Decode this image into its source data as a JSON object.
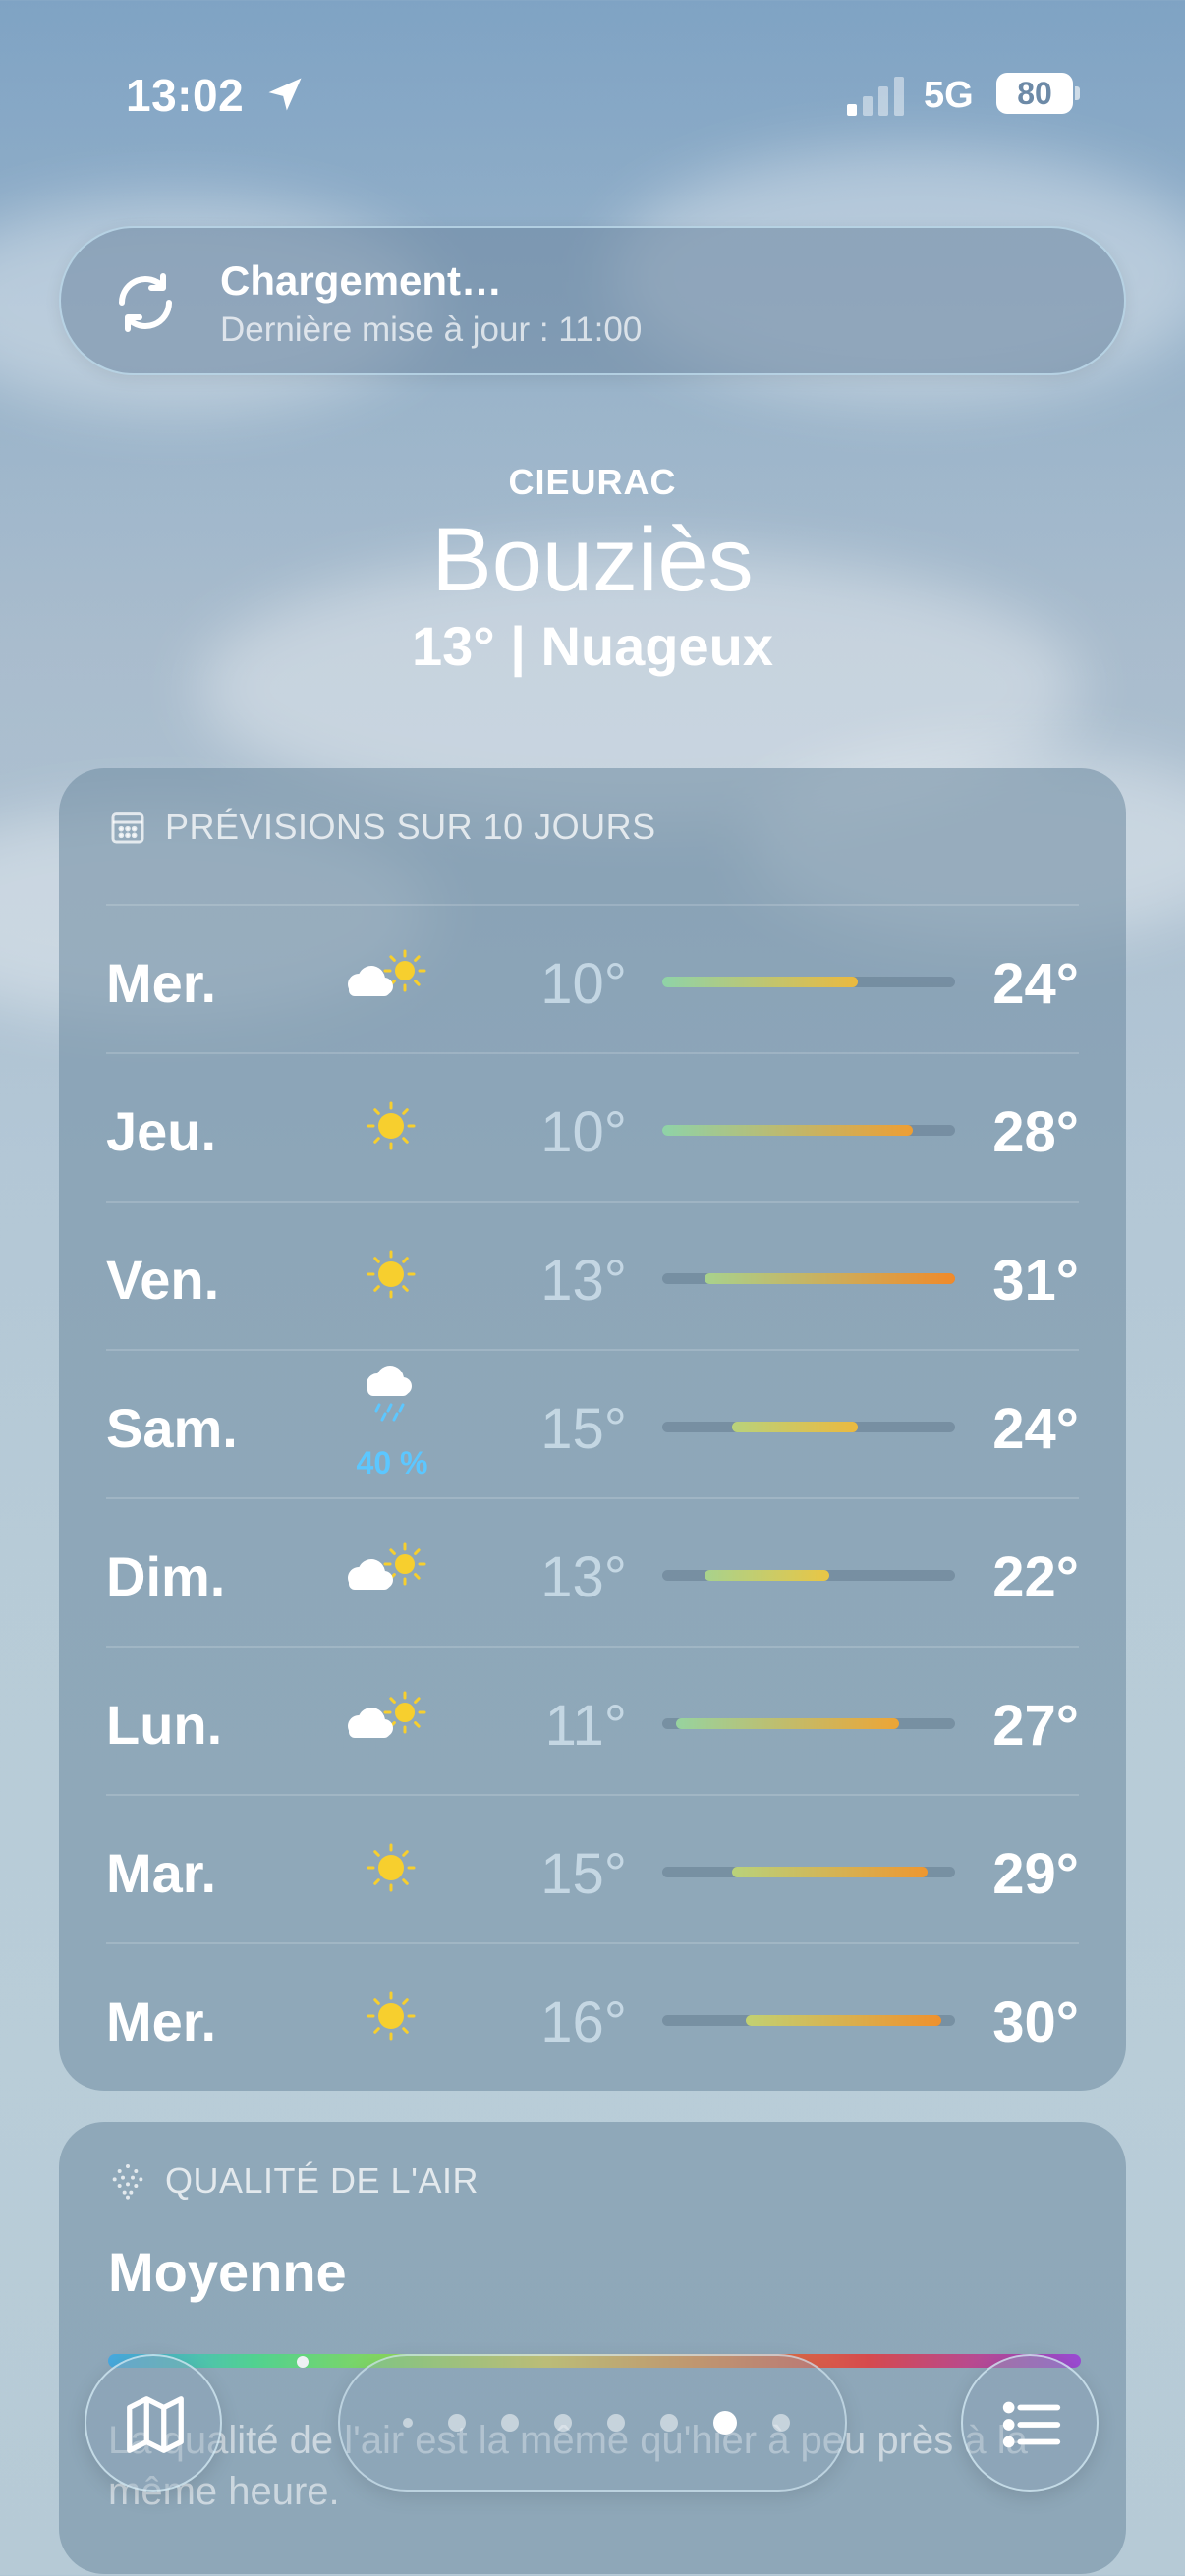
{
  "status": {
    "time": "13:02",
    "network": "5G",
    "battery": "80"
  },
  "loading": {
    "title": "Chargement…",
    "subtitle": "Dernière mise à jour : 11:00"
  },
  "location": {
    "region": "CIEURAC",
    "city": "Bouziès",
    "current": "13°  |  Nuageux"
  },
  "forecast": {
    "title": "PRÉVISIONS SUR 10 JOURS",
    "range_min": 10,
    "range_max": 31,
    "days": [
      {
        "day": "Mer.",
        "icon": "partly-cloudy-icon",
        "low": "10°",
        "high": "24°",
        "low_v": 10,
        "high_v": 24,
        "pop": ""
      },
      {
        "day": "Jeu.",
        "icon": "sun-icon",
        "low": "10°",
        "high": "28°",
        "low_v": 10,
        "high_v": 28,
        "pop": ""
      },
      {
        "day": "Ven.",
        "icon": "sun-icon",
        "low": "13°",
        "high": "31°",
        "low_v": 13,
        "high_v": 31,
        "pop": ""
      },
      {
        "day": "Sam.",
        "icon": "rain-cloud-icon",
        "low": "15°",
        "high": "24°",
        "low_v": 15,
        "high_v": 24,
        "pop": "40 %"
      },
      {
        "day": "Dim.",
        "icon": "partly-cloudy-icon",
        "low": "13°",
        "high": "22°",
        "low_v": 13,
        "high_v": 22,
        "pop": ""
      },
      {
        "day": "Lun.",
        "icon": "partly-cloudy-icon",
        "low": "11°",
        "high": "27°",
        "low_v": 11,
        "high_v": 27,
        "pop": ""
      },
      {
        "day": "Mar.",
        "icon": "sun-icon",
        "low": "15°",
        "high": "29°",
        "low_v": 15,
        "high_v": 29,
        "pop": ""
      },
      {
        "day": "Mer.",
        "icon": "sun-icon",
        "low": "16°",
        "high": "30°",
        "low_v": 16,
        "high_v": 30,
        "pop": ""
      }
    ]
  },
  "air": {
    "title": "QUALITÉ DE L'AIR",
    "quality": "Moyenne",
    "level": 0.2,
    "description": "La qualité de l'air est la même qu'hier à peu près à la même heure."
  },
  "pager": {
    "pages": 8,
    "active": 7
  },
  "colors": {
    "cool": "#8fd3a8",
    "mild": "#e8d04a",
    "warm": "#f08a2a",
    "pop": "#5cc7ff"
  }
}
